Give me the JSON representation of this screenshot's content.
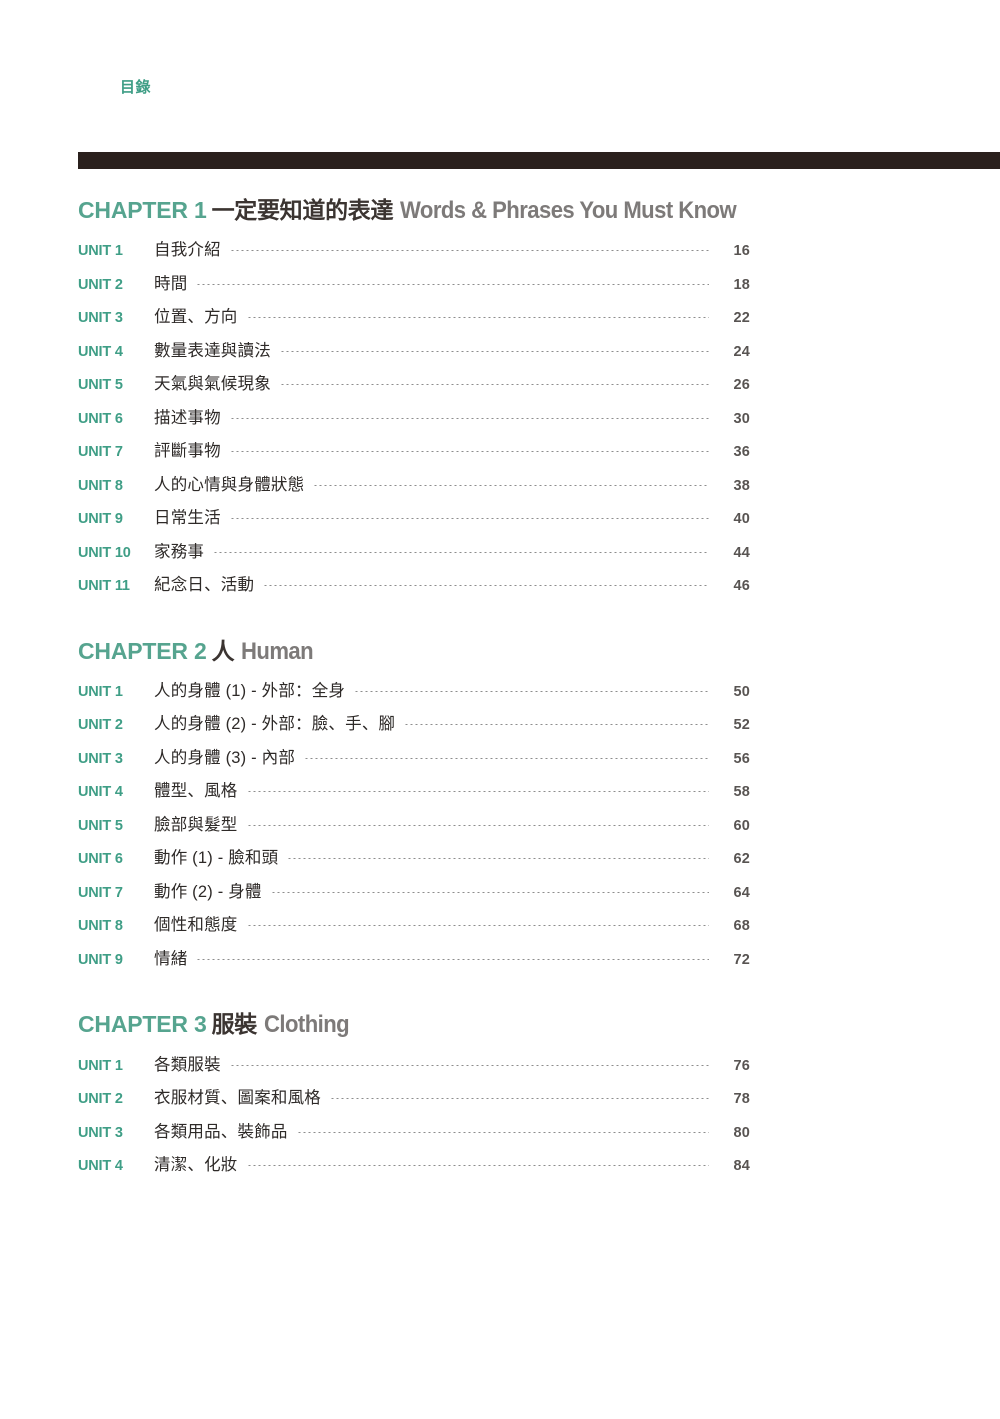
{
  "header": {
    "running_title": "目錄",
    "accent_color": "#3f9e86",
    "rule_color": "#2a201d"
  },
  "chapters": [
    {
      "label": "CHAPTER 1",
      "title_zh": "一定要知道的表達",
      "title_en": "Words & Phrases You Must Know",
      "units": [
        {
          "label": "UNIT 1",
          "title": "自我介紹",
          "page": "16"
        },
        {
          "label": "UNIT 2",
          "title": "時間",
          "page": "18"
        },
        {
          "label": "UNIT 3",
          "title": "位置、方向",
          "page": "22"
        },
        {
          "label": "UNIT 4",
          "title": "數量表達與讀法",
          "page": "24"
        },
        {
          "label": "UNIT 5",
          "title": "天氣與氣候現象",
          "page": "26"
        },
        {
          "label": "UNIT 6",
          "title": "描述事物",
          "page": "30"
        },
        {
          "label": "UNIT 7",
          "title": "評斷事物",
          "page": "36"
        },
        {
          "label": "UNIT 8",
          "title": "人的心情與身體狀態",
          "page": "38"
        },
        {
          "label": "UNIT 9",
          "title": "日常生活",
          "page": "40"
        },
        {
          "label": "UNIT 10",
          "title": "家務事",
          "page": "44"
        },
        {
          "label": "UNIT 11",
          "title": "紀念日、活動",
          "page": "46"
        }
      ]
    },
    {
      "label": "CHAPTER 2",
      "title_zh": "人",
      "title_en": "Human",
      "units": [
        {
          "label": "UNIT 1",
          "title": "人的身體 (1) - 外部：全身",
          "page": "50"
        },
        {
          "label": "UNIT 2",
          "title": "人的身體 (2) - 外部：臉、手、腳",
          "page": "52"
        },
        {
          "label": "UNIT 3",
          "title": "人的身體 (3) - 內部",
          "page": "56"
        },
        {
          "label": "UNIT 4",
          "title": "體型、風格",
          "page": "58"
        },
        {
          "label": "UNIT 5",
          "title": "臉部與髮型",
          "page": "60"
        },
        {
          "label": "UNIT 6",
          "title": "動作 (1) - 臉和頭",
          "page": "62"
        },
        {
          "label": "UNIT 7",
          "title": "動作 (2) - 身體",
          "page": "64"
        },
        {
          "label": "UNIT 8",
          "title": "個性和態度",
          "page": "68"
        },
        {
          "label": "UNIT 9",
          "title": "情緒",
          "page": "72"
        }
      ]
    },
    {
      "label": "CHAPTER 3",
      "title_zh": "服裝",
      "title_en": "Clothing",
      "units": [
        {
          "label": "UNIT 1",
          "title": "各類服裝",
          "page": "76"
        },
        {
          "label": "UNIT 2",
          "title": "衣服材質、圖案和風格",
          "page": "78"
        },
        {
          "label": "UNIT 3",
          "title": "各類用品、裝飾品",
          "page": "80"
        },
        {
          "label": "UNIT 4",
          "title": "清潔、化妝",
          "page": "84"
        }
      ]
    }
  ]
}
